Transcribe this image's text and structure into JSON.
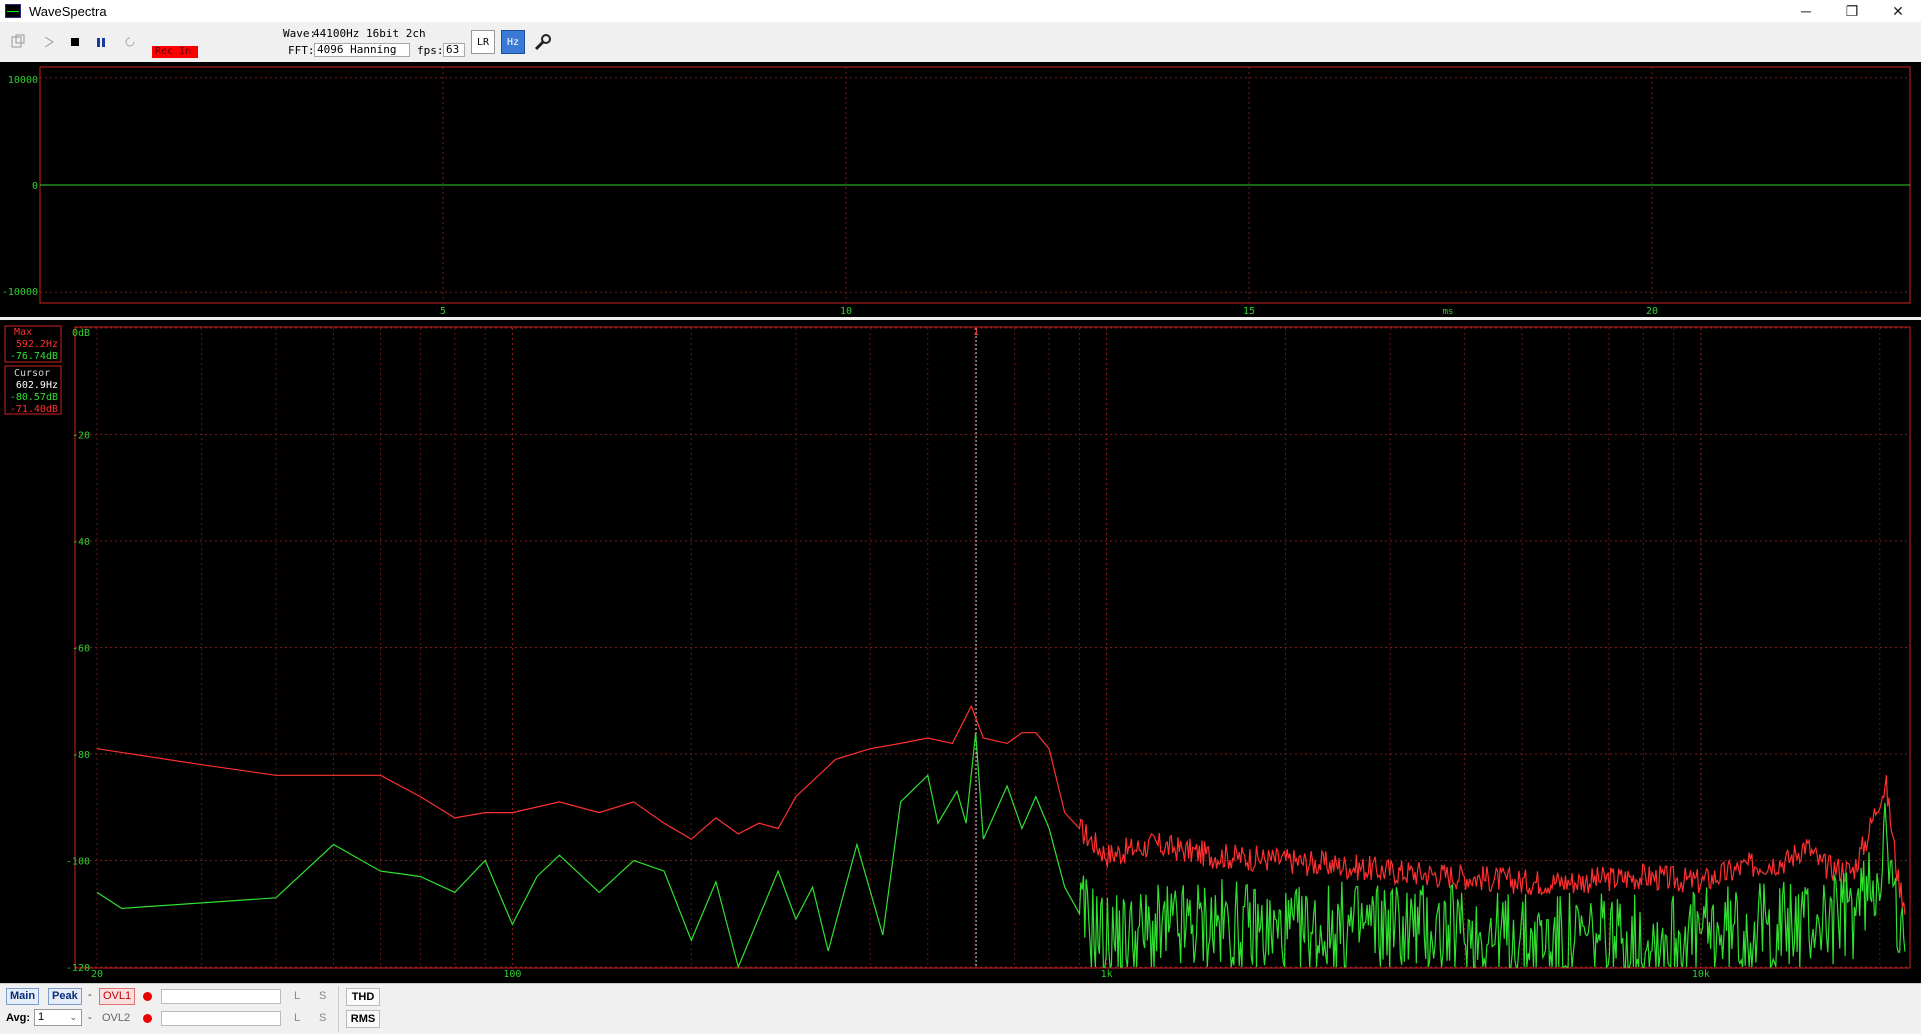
{
  "window": {
    "title": "WaveSpectra",
    "min": "─",
    "restore": "❐",
    "close": "✕"
  },
  "toolbar": {
    "rec_label": "Rec In",
    "wave_label": "Wave:",
    "wave_value": "44100Hz 16bit 2ch",
    "fft_label": "FFT:",
    "fft_value": "4096 Hanning",
    "fps_label": "fps:",
    "fps_value": "63",
    "lr_label": "LR",
    "hz_label": "Hz"
  },
  "wave_plot": {
    "y_ticks": [
      10000,
      0,
      -10000
    ],
    "y_labels": [
      "10000",
      "0",
      "-10000"
    ],
    "x_ticks": [
      5,
      10,
      15,
      20
    ],
    "x_labels": [
      "5",
      "10",
      "15",
      "20"
    ],
    "x_unit": "ms",
    "x_range": [
      0,
      23.2
    ],
    "y_range": [
      -11000,
      11000
    ]
  },
  "spectrum_plot": {
    "y_labels": [
      "0dB",
      "-20",
      "-40",
      "-60",
      "-80",
      "-100",
      "-120"
    ],
    "y_values": [
      0,
      -20,
      -40,
      -60,
      -80,
      -100,
      -120
    ],
    "x_labels": [
      "20",
      "100",
      "1k",
      "10k"
    ],
    "x_values": [
      20,
      100,
      1000,
      10000
    ],
    "x_range": [
      20,
      22050
    ],
    "y_range": [
      -120,
      0
    ],
    "cursor_freq": 602.9,
    "cursor_marker": "1",
    "max_box": {
      "title": "Max",
      "freq": "592.2Hz",
      "db": "-76.74dB"
    },
    "cursor_box": {
      "title": "Cursor",
      "freq": "602.9Hz",
      "db_green": "-80.57dB",
      "db_red": "-71.40dB"
    },
    "colors": {
      "left_channel": "#ff3030",
      "right_channel": "#30e030",
      "grid": "#8a1a1a",
      "frame": "#cc2020"
    }
  },
  "chart_data": [
    {
      "type": "line",
      "title": "",
      "xlabel": "ms",
      "ylabel": "",
      "xlim": [
        0,
        23.2
      ],
      "ylim": [
        -11000,
        11000
      ],
      "series": [
        {
          "values": [
            [
              0,
              0
            ],
            [
              23.2,
              0
            ]
          ]
        }
      ]
    },
    {
      "type": "line",
      "title": "",
      "xlabel": "",
      "ylabel": "",
      "xscale": "log",
      "xlim": [
        20,
        22050
      ],
      "ylim": [
        -120,
        0
      ],
      "series": [
        {
          "color": "#ff3030",
          "values": [
            [
              20,
              -79
            ],
            [
              30,
              -82
            ],
            [
              40,
              -84
            ],
            [
              50,
              -84
            ],
            [
              60,
              -84
            ],
            [
              70,
              -88
            ],
            [
              80,
              -92
            ],
            [
              90,
              -91
            ],
            [
              100,
              -91
            ],
            [
              120,
              -89
            ],
            [
              140,
              -91
            ],
            [
              160,
              -89
            ],
            [
              180,
              -93
            ],
            [
              200,
              -96
            ],
            [
              220,
              -92
            ],
            [
              240,
              -95
            ],
            [
              260,
              -93
            ],
            [
              280,
              -94
            ],
            [
              300,
              -88
            ],
            [
              350,
              -81
            ],
            [
              400,
              -79
            ],
            [
              450,
              -78
            ],
            [
              500,
              -77
            ],
            [
              550,
              -78
            ],
            [
              592,
              -71
            ],
            [
              620,
              -77
            ],
            [
              680,
              -78
            ],
            [
              720,
              -76
            ],
            [
              760,
              -76
            ],
            [
              800,
              -79
            ],
            [
              850,
              -91
            ],
            [
              900,
              -94
            ],
            [
              1000,
              -99
            ],
            [
              1200,
              -97
            ],
            [
              1500,
              -99
            ],
            [
              2000,
              -100
            ],
            [
              2500,
              -101
            ],
            [
              3000,
              -102
            ],
            [
              4000,
              -103
            ],
            [
              5000,
              -104
            ],
            [
              6000,
              -104
            ],
            [
              8000,
              -103
            ],
            [
              10000,
              -104
            ],
            [
              12000,
              -101
            ],
            [
              14000,
              -100
            ],
            [
              15000,
              -97
            ],
            [
              16000,
              -101
            ],
            [
              18000,
              -102
            ],
            [
              19000,
              -96
            ],
            [
              20000,
              -88
            ],
            [
              20500,
              -86
            ],
            [
              21500,
              -104
            ],
            [
              22050,
              -108
            ]
          ]
        },
        {
          "color": "#30e030",
          "values": [
            [
              20,
              -106
            ],
            [
              22,
              -109
            ],
            [
              40,
              -107
            ],
            [
              50,
              -97
            ],
            [
              60,
              -102
            ],
            [
              70,
              -103
            ],
            [
              80,
              -106
            ],
            [
              90,
              -100
            ],
            [
              100,
              -112
            ],
            [
              110,
              -103
            ],
            [
              120,
              -99
            ],
            [
              140,
              -106
            ],
            [
              160,
              -100
            ],
            [
              180,
              -102
            ],
            [
              200,
              -115
            ],
            [
              220,
              -104
            ],
            [
              240,
              -120
            ],
            [
              280,
              -102
            ],
            [
              300,
              -111
            ],
            [
              320,
              -105
            ],
            [
              340,
              -117
            ],
            [
              380,
              -97
            ],
            [
              420,
              -114
            ],
            [
              450,
              -89
            ],
            [
              500,
              -84
            ],
            [
              520,
              -93
            ],
            [
              560,
              -87
            ],
            [
              580,
              -93
            ],
            [
              602,
              -76
            ],
            [
              620,
              -96
            ],
            [
              680,
              -86
            ],
            [
              720,
              -94
            ],
            [
              760,
              -88
            ],
            [
              800,
              -94
            ],
            [
              850,
              -105
            ],
            [
              900,
              -110
            ],
            [
              1000,
              -115
            ],
            [
              1500,
              -112
            ],
            [
              2000,
              -114
            ],
            [
              3000,
              -112
            ],
            [
              5000,
              -115
            ],
            [
              8000,
              -115
            ],
            [
              10000,
              -114
            ],
            [
              15000,
              -112
            ],
            [
              18000,
              -110
            ],
            [
              19500,
              -104
            ],
            [
              20500,
              -96
            ],
            [
              21500,
              -115
            ],
            [
              22050,
              -118
            ]
          ]
        }
      ]
    }
  ],
  "status": {
    "main": "Main",
    "peak": "Peak",
    "dash": "-",
    "ovl1": "OVL1",
    "ovl2": "OVL2",
    "avg_label": "Avg:",
    "avg_value": "1",
    "l": "L",
    "s": "S",
    "thd": "THD",
    "rms": "RMS"
  }
}
